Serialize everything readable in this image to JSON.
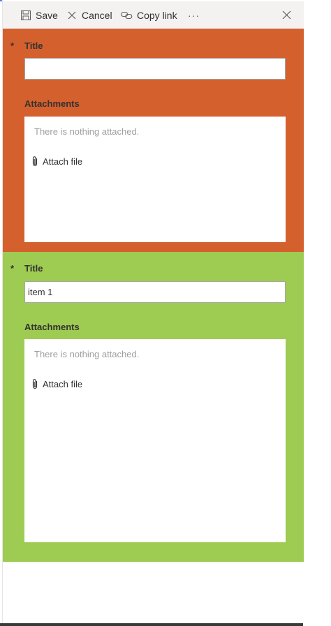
{
  "toolbar": {
    "save_label": "Save",
    "cancel_label": "Cancel",
    "copy_link_label": "Copy link",
    "more_label": "···"
  },
  "form": [
    {
      "required_mark": "*",
      "title_label": "Title",
      "title_value": "",
      "attachments_label": "Attachments",
      "empty_message": "There is nothing attached.",
      "attach_label": "Attach file",
      "background": "#d4602e"
    },
    {
      "required_mark": "*",
      "title_label": "Title",
      "title_value": "item 1",
      "attachments_label": "Attachments",
      "empty_message": "There is nothing attached.",
      "attach_label": "Attach file",
      "background": "#9ecb52"
    }
  ]
}
